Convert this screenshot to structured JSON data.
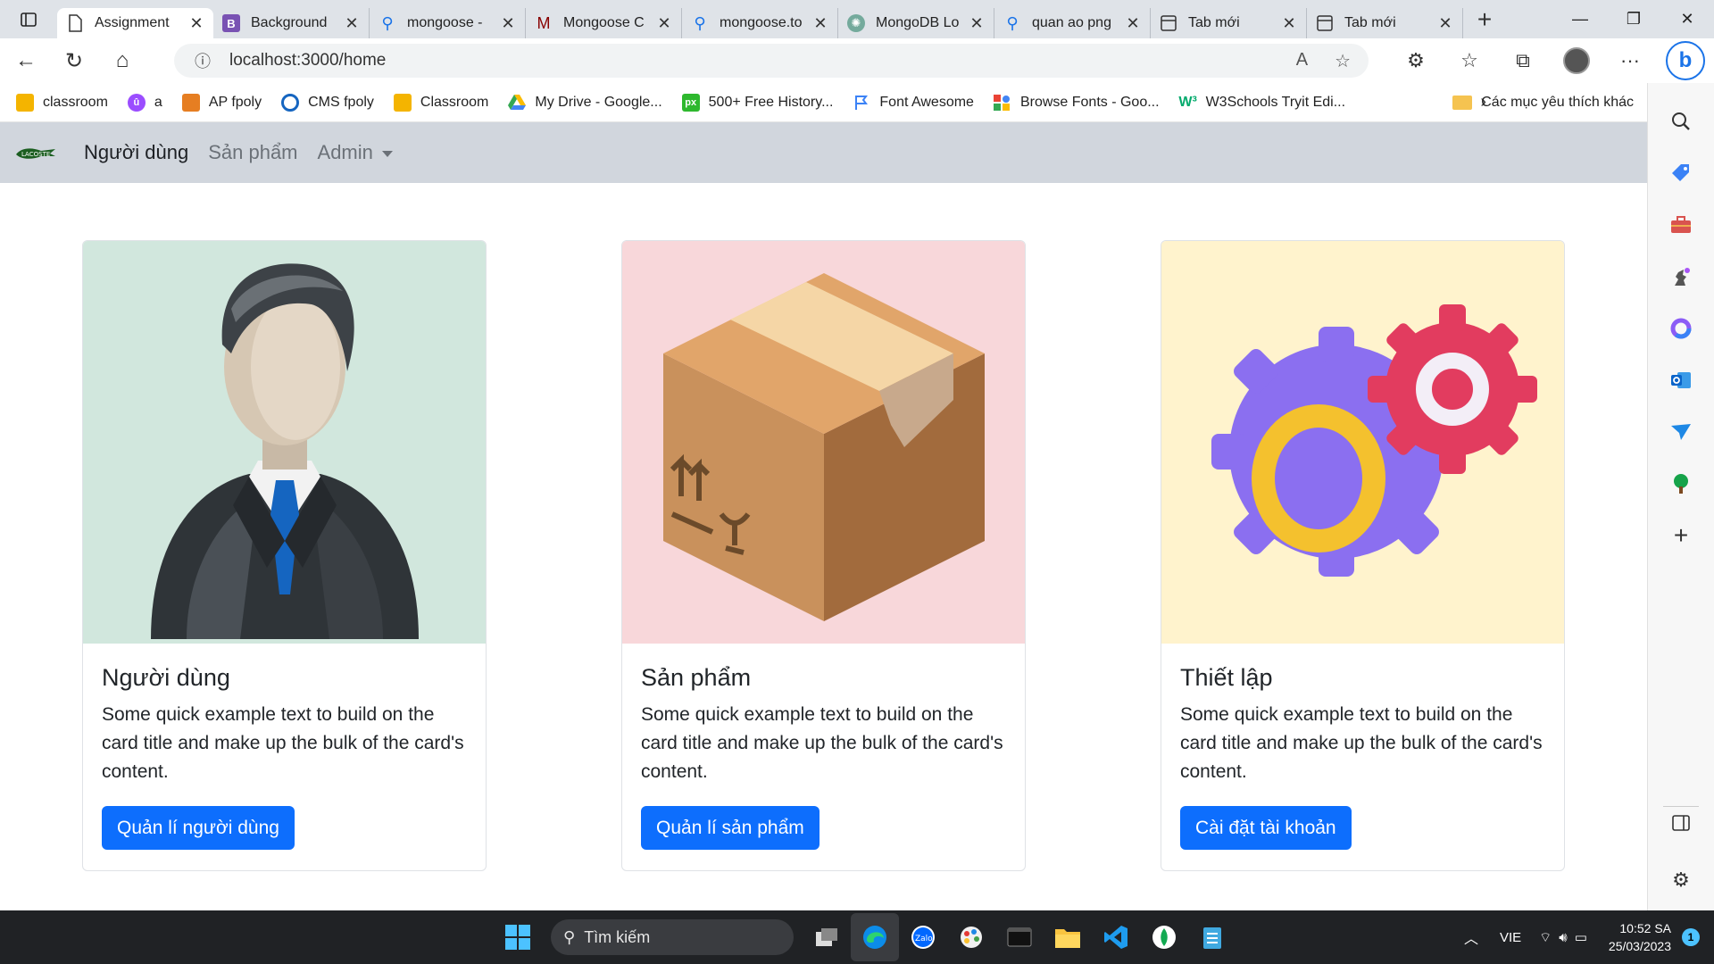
{
  "browser": {
    "tabs": [
      {
        "label": "Assignment",
        "icon": "page-icon",
        "active": true
      },
      {
        "label": "Background",
        "icon": "bootstrap-icon"
      },
      {
        "label": "mongoose -",
        "icon": "search-icon"
      },
      {
        "label": "Mongoose C",
        "icon": "mongoose-icon"
      },
      {
        "label": "mongoose.to",
        "icon": "search-icon"
      },
      {
        "label": "MongoDB Lo",
        "icon": "chatgpt-icon"
      },
      {
        "label": "quan ao png",
        "icon": "search-icon"
      },
      {
        "label": "Tab mới",
        "icon": "newtab-icon"
      },
      {
        "label": "Tab mới",
        "icon": "newtab-icon"
      }
    ],
    "url": "localhost:3000/home",
    "bookmarks": [
      {
        "label": "classroom",
        "color": "#f4b400"
      },
      {
        "label": "a",
        "color": "#9b4dff"
      },
      {
        "label": "AP fpoly",
        "color": "#e67e22"
      },
      {
        "label": "CMS fpoly",
        "color": "#1565c0"
      },
      {
        "label": "Classroom",
        "color": "#f4b400"
      },
      {
        "label": "My Drive - Google...",
        "color": "#34a853"
      },
      {
        "label": "500+ Free History...",
        "color": "#2eb82e"
      },
      {
        "label": "Font Awesome",
        "color": "#3b82f6"
      },
      {
        "label": "Browse Fonts - Goo...",
        "color": "#ea4335"
      },
      {
        "label": "W3Schools Tryit Edi...",
        "color": "#04aa6d"
      }
    ],
    "bookmarks_folder": "Các mục yêu thích khác"
  },
  "navbar": {
    "brand": "LACOSTE",
    "links": [
      "Người dùng",
      "Sản phẩm"
    ],
    "dropdown": "Admin"
  },
  "cards": [
    {
      "title": "Người dùng",
      "text": "Some quick example text to build on the card title and make up the bulk of the card's content.",
      "button": "Quản lí người dùng",
      "bg": "#d1e7dd"
    },
    {
      "title": "Sản phẩm",
      "text": "Some quick example text to build on the card title and make up the bulk of the card's content.",
      "button": "Quản lí sản phẩm",
      "bg": "#f8d7da"
    },
    {
      "title": "Thiết lập",
      "text": "Some quick example text to build on the card title and make up the bulk of the card's content.",
      "button": "Cài đặt tài khoản",
      "bg": "#fff3cd"
    }
  ],
  "taskbar": {
    "search_placeholder": "Tìm kiếm",
    "lang": "VIE",
    "time": "10:52 SA",
    "date": "25/03/2023",
    "notifications": "1"
  },
  "colors": {
    "primary": "#0d6efd",
    "navbar_bg": "#d1d6dd"
  }
}
